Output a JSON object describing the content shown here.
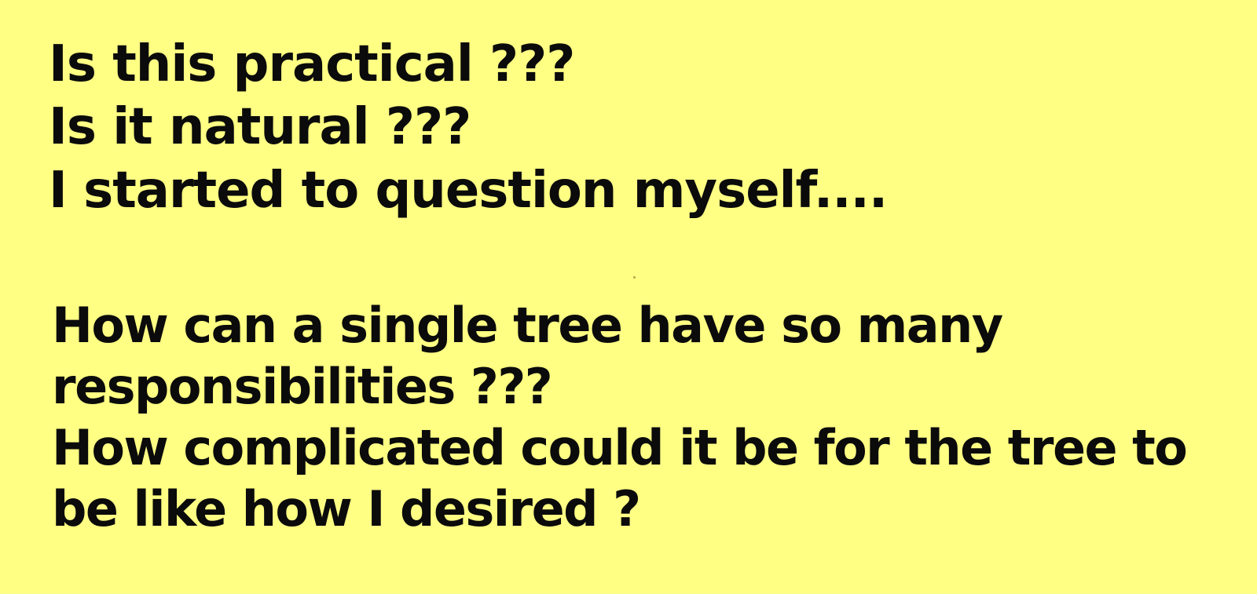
{
  "background_color": "#ffff84",
  "text_color": "#0b0b0b",
  "text_block_1": {
    "line_1": "Is this practical ???",
    "line_2": "Is it natural ???",
    "line_3": "I started to question myself...."
  },
  "text_block_2": {
    "line_1": "How can a single tree have so many",
    "line_2": "responsibilities ???",
    "line_3": "How complicated could it be for the tree to",
    "line_4": "be like how I desired ?"
  }
}
